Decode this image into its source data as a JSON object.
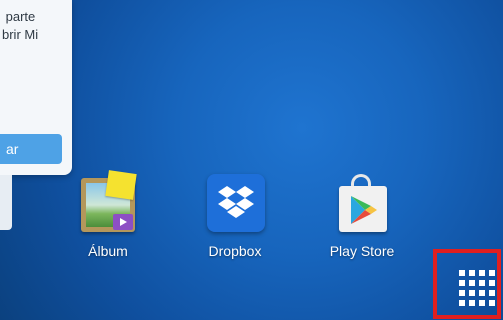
{
  "card": {
    "text": " parte\nbrir Mi",
    "button_label": "ar"
  },
  "apps": [
    {
      "label": "Álbum",
      "icon": "album-icon"
    },
    {
      "label": "Dropbox",
      "icon": "dropbox-icon"
    },
    {
      "label": "Play Store",
      "icon": "play-store-icon"
    }
  ],
  "drawer": {
    "icon": "app-drawer-grid-icon",
    "highlight_color": "#e01f1f"
  },
  "colors": {
    "wallpaper": "#1765bd",
    "card_button": "#4ea2e6",
    "dropbox": "#1e6fd9"
  }
}
